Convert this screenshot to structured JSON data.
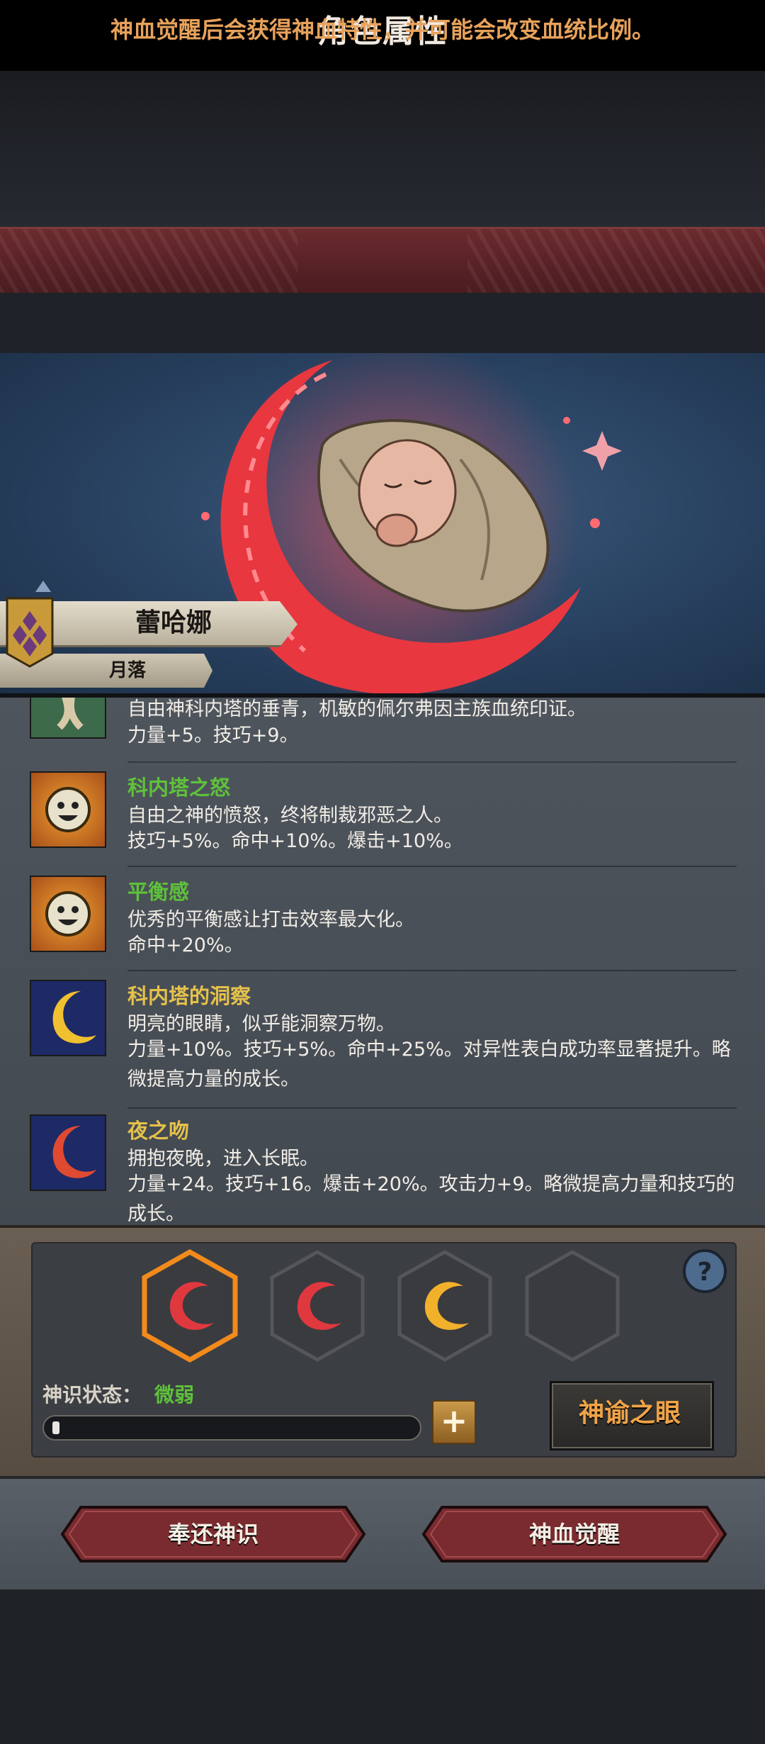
{
  "header": {
    "title": "角色属性",
    "hint": "神血觉醒后会获得神血特性，并可能会改变血统比例。"
  },
  "character": {
    "name": "蕾哈娜",
    "title": "月落"
  },
  "traits": [
    {
      "name": "",
      "description": "自由神科内塔的垂青，机敏的佩尔弗因主族血统印证。",
      "effects": "力量+5。技巧+9。",
      "icon": "root-icon",
      "name_color": "#5ec23a"
    },
    {
      "name": "科内塔之怒",
      "description": "自由之神的愤怒，终将制裁邪恶之人。",
      "effects": "技巧+5%。命中+10%。爆击+10%。",
      "icon": "smiley-sun-icon",
      "name_color": "#5ec23a"
    },
    {
      "name": "平衡感",
      "description": "优秀的平衡感让打击效率最大化。",
      "effects": "命中+20%。",
      "icon": "smiley-sun-icon",
      "name_color": "#5ec23a"
    },
    {
      "name": "科内塔的洞察",
      "description": "明亮的眼睛，似乎能洞察万物。",
      "effects": "力量+10%。技巧+5%。命中+25%。对异性表白成功率显著提升。略微提高力量的成长。",
      "icon": "golden-crescent-icon",
      "name_color": "#e5c14a"
    },
    {
      "name": "夜之吻",
      "description": "拥抱夜晚，进入长眠。",
      "effects": "力量+24。技巧+16。爆击+20%。攻击力+9。略微提高力量和技巧的成长。",
      "icon": "red-crescent-icon",
      "name_color": "#e5c14a"
    }
  ],
  "panel": {
    "status_label": "神识状态：",
    "status_value": "微弱",
    "progress": 0.02,
    "oracle_button": "神谕之眼",
    "slots": [
      {
        "state": "selected",
        "color": "#e0383f"
      },
      {
        "state": "filled",
        "color": "#e0383f"
      },
      {
        "state": "filled",
        "color": "#f2b12a"
      },
      {
        "state": "empty",
        "color": ""
      }
    ]
  },
  "actions": {
    "return_button": "奉还神识",
    "awaken_button": "神血觉醒"
  }
}
